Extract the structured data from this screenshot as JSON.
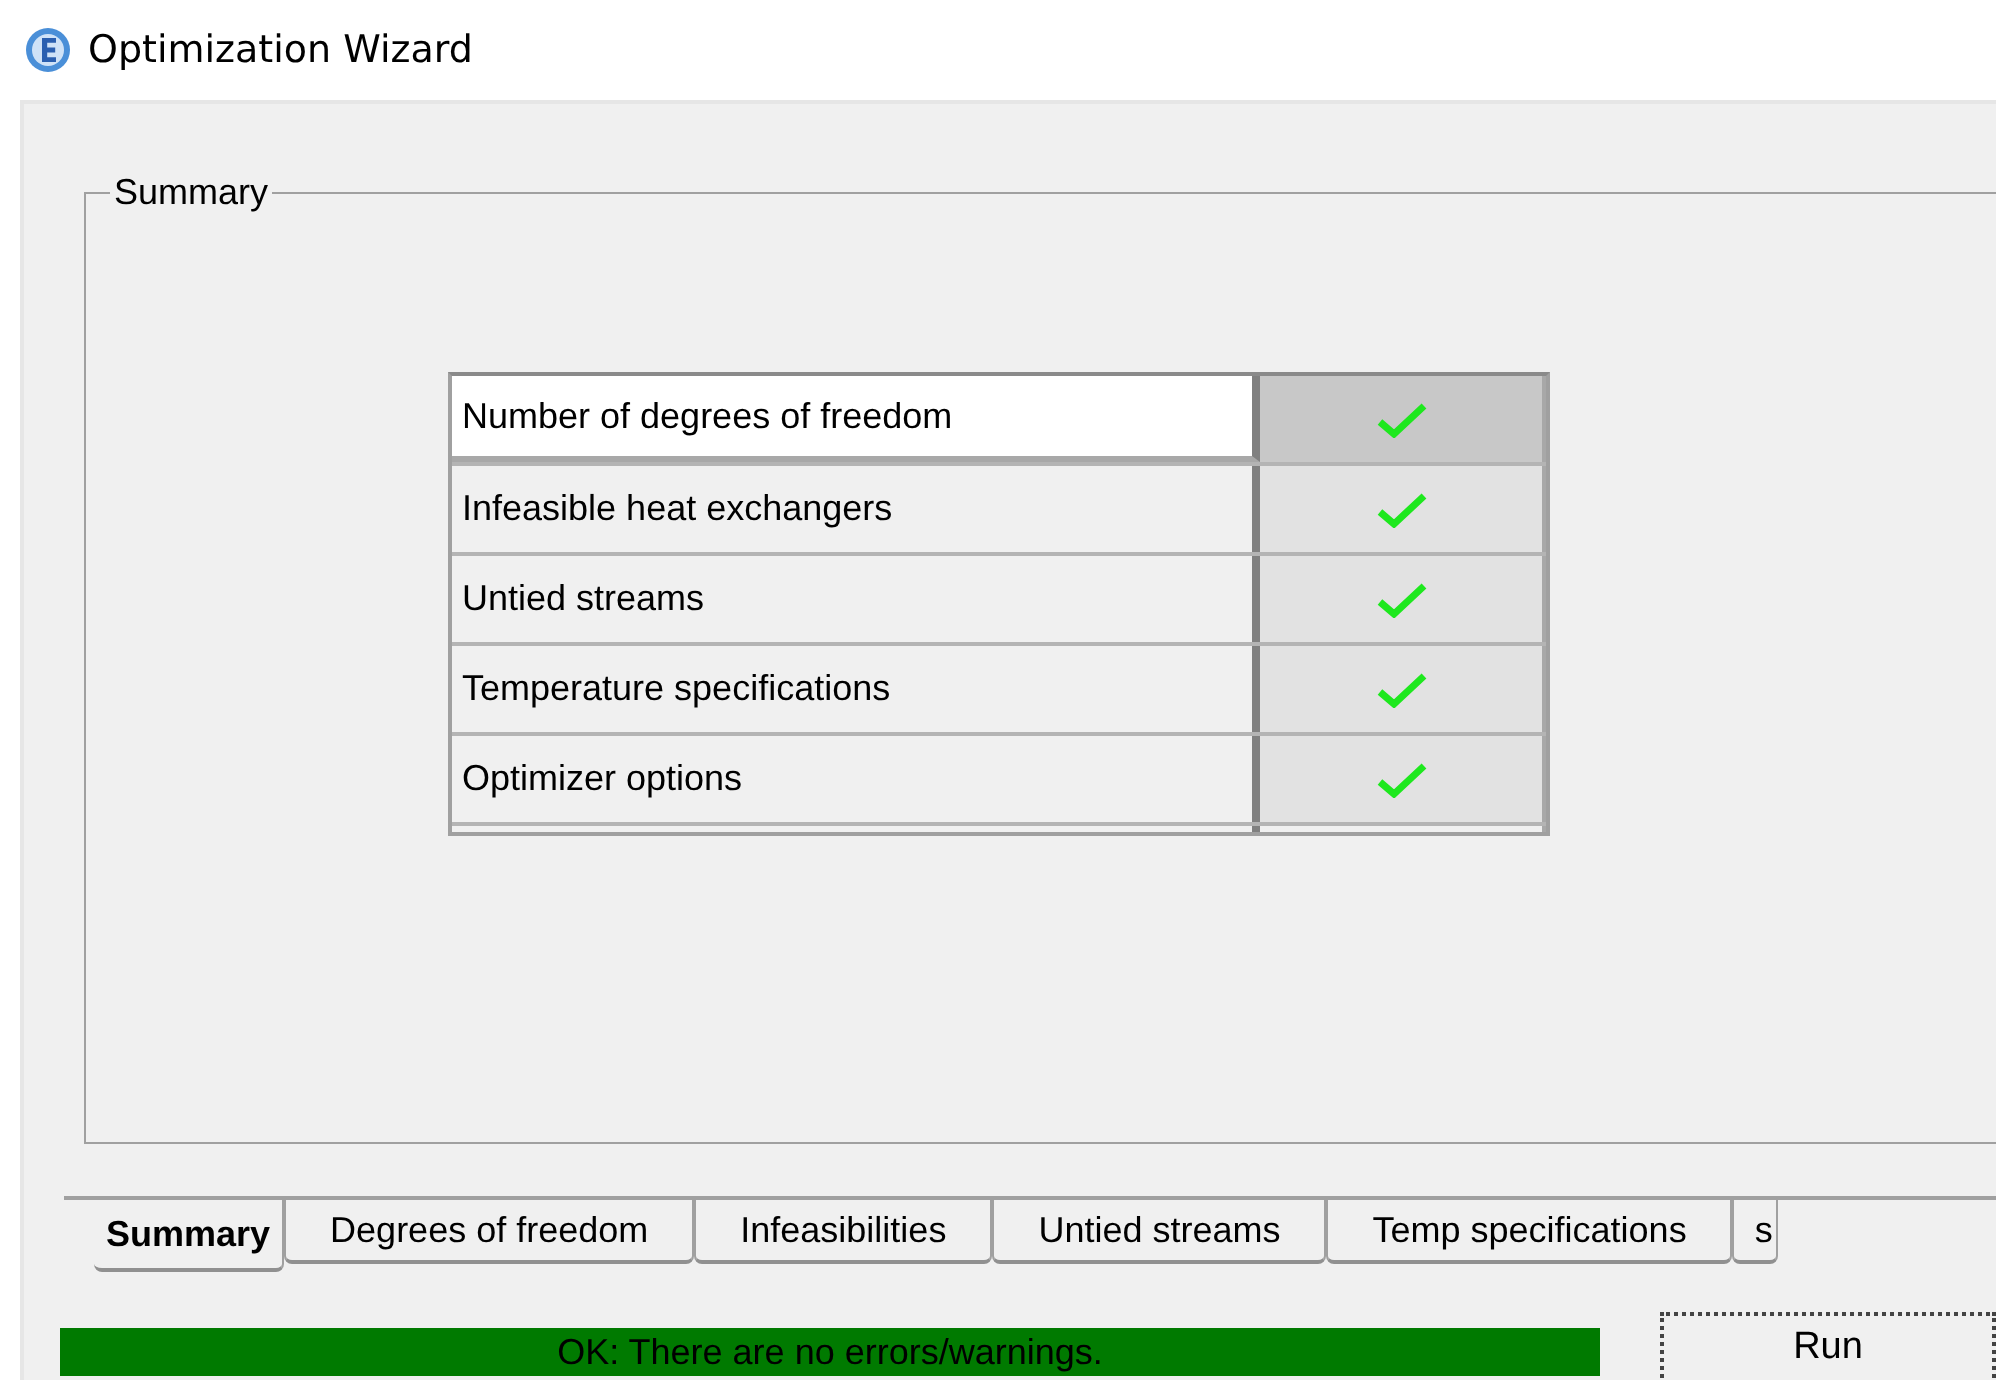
{
  "window": {
    "title": "Optimization Wizard"
  },
  "group": {
    "title": "Summary"
  },
  "rows": [
    {
      "label": "Number of degrees of freedom",
      "ok": true,
      "selected": true
    },
    {
      "label": "Infeasible heat exchangers",
      "ok": true,
      "selected": false
    },
    {
      "label": "Untied streams",
      "ok": true,
      "selected": false
    },
    {
      "label": "Temperature specifications",
      "ok": true,
      "selected": false
    },
    {
      "label": "Optimizer options",
      "ok": true,
      "selected": false
    }
  ],
  "tabs": [
    {
      "label": "Summary",
      "selected": true
    },
    {
      "label": "Degrees of freedom",
      "selected": false
    },
    {
      "label": "Infeasibilities",
      "selected": false
    },
    {
      "label": "Untied streams",
      "selected": false
    },
    {
      "label": "Temp specifications",
      "selected": false
    },
    {
      "label": "s",
      "selected": false
    }
  ],
  "status": {
    "text": "OK: There are no errors/warnings.",
    "ok": true
  },
  "buttons": [
    {
      "label": "Run"
    }
  ]
}
